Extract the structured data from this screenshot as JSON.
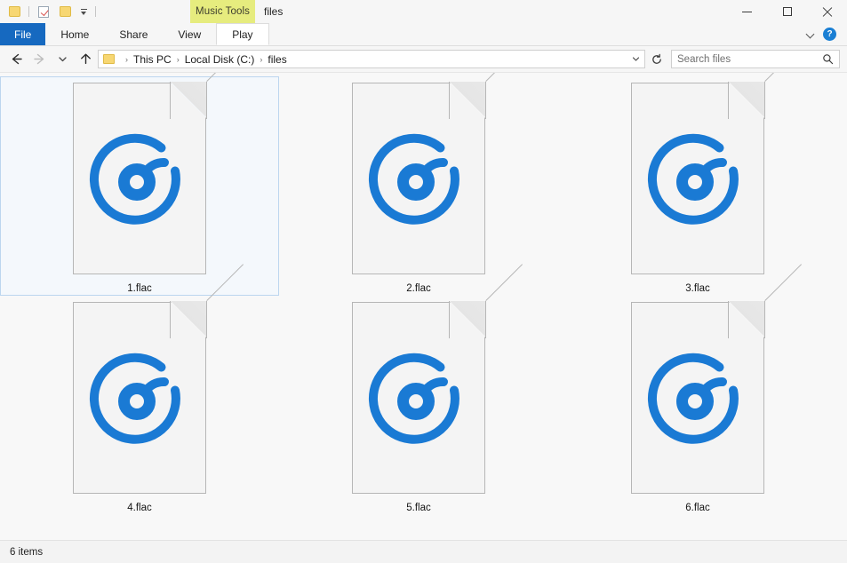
{
  "window": {
    "title": "files",
    "contextual_group": "Music Tools",
    "quick_access": [
      {
        "name": "folder-icon",
        "label": "Folder"
      },
      {
        "name": "properties-icon",
        "label": "Properties"
      },
      {
        "name": "new-folder-icon",
        "label": "New folder"
      },
      {
        "name": "customize-caret-icon",
        "label": "Customize Quick Access Toolbar"
      }
    ],
    "controls": {
      "minimize": "Minimize",
      "maximize": "Maximize",
      "close": "Close"
    }
  },
  "ribbon": {
    "tabs": [
      {
        "label": "File",
        "active": false,
        "style": "file"
      },
      {
        "label": "Home",
        "active": false,
        "style": "normal"
      },
      {
        "label": "Share",
        "active": false,
        "style": "normal"
      },
      {
        "label": "View",
        "active": false,
        "style": "normal"
      },
      {
        "label": "Play",
        "active": true,
        "style": "normal"
      }
    ],
    "collapse_label": "Minimize the Ribbon",
    "help_label": "?"
  },
  "address": {
    "back_label": "Back",
    "forward_label": "Forward",
    "recent_label": "Recent locations",
    "up_label": "Up",
    "breadcrumbs": [
      "This PC",
      "Local Disk (C:)",
      "files"
    ],
    "separator": "›",
    "dropdown_label": "Previous locations",
    "refresh_label": "Refresh"
  },
  "search": {
    "placeholder": "Search files",
    "value": "",
    "icon": "search-icon"
  },
  "files": [
    {
      "name": "1.flac",
      "type": "flac-audio-file",
      "selected": true
    },
    {
      "name": "2.flac",
      "type": "flac-audio-file",
      "selected": false
    },
    {
      "name": "3.flac",
      "type": "flac-audio-file",
      "selected": false
    },
    {
      "name": "4.flac",
      "type": "flac-audio-file",
      "selected": false
    },
    {
      "name": "5.flac",
      "type": "flac-audio-file",
      "selected": false
    },
    {
      "name": "6.flac",
      "type": "flac-audio-file",
      "selected": false
    }
  ],
  "status": {
    "item_count": "6 items"
  },
  "colors": {
    "accent_blue": "#1a7ad4",
    "file_tab_blue": "#1669c0",
    "contextual_yellow": "#e6ec7e",
    "selection_fill": "#f4f8fc",
    "selection_border": "#bcd6ef",
    "page_fill": "#f4f4f4",
    "page_border": "#b6b6b6"
  }
}
